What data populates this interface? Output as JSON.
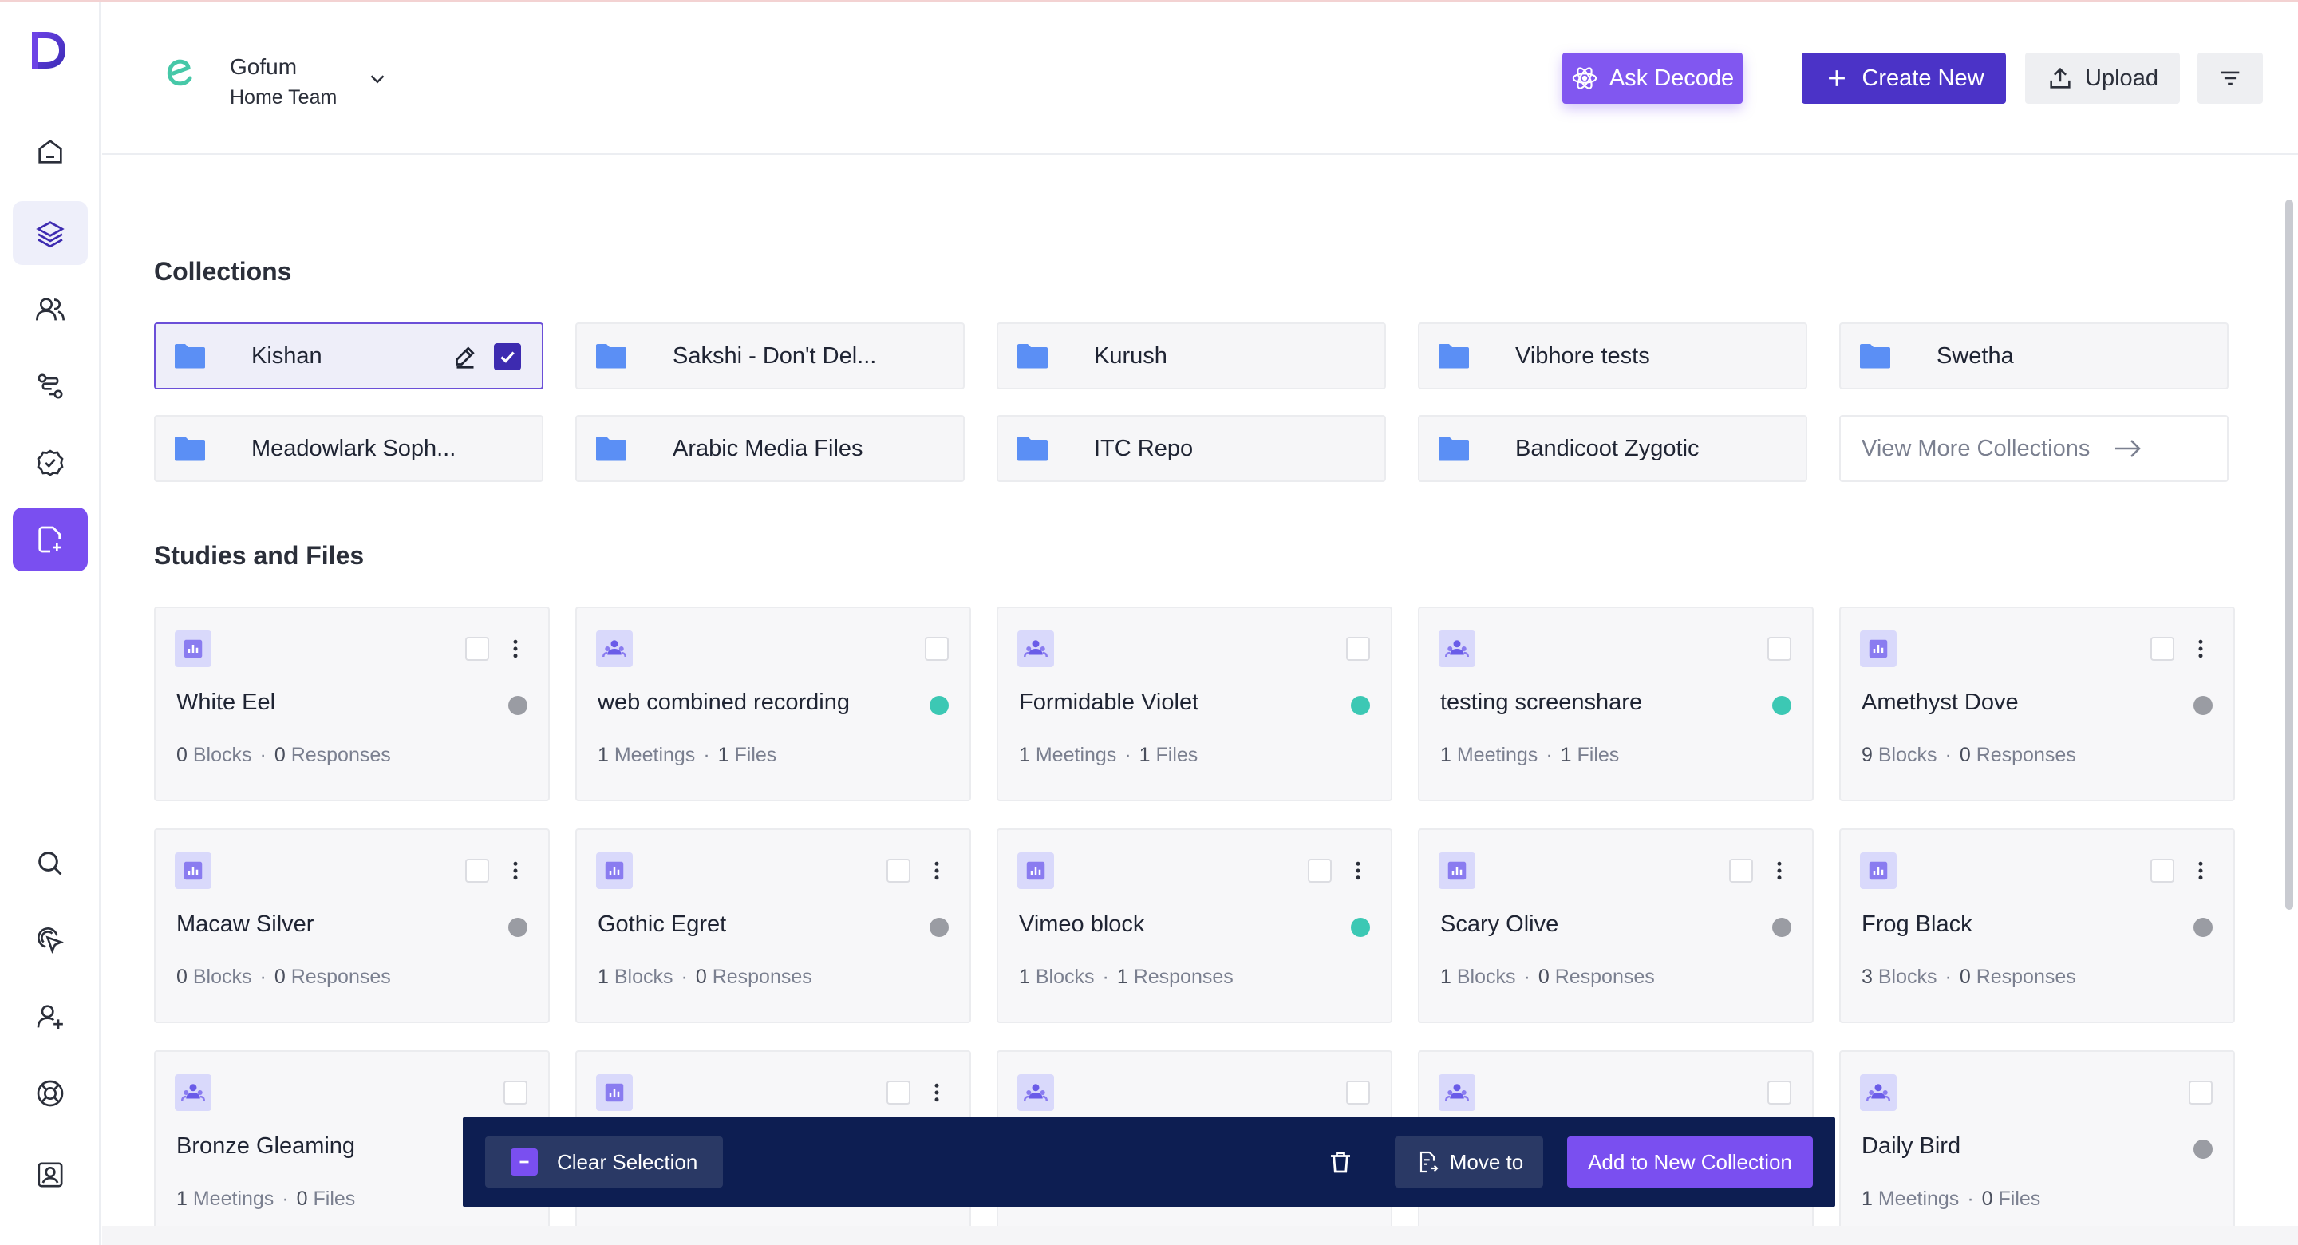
{
  "header": {
    "team_name": "Gofum",
    "team_sub": "Home Team",
    "ask_label": "Ask Decode",
    "create_label": "Create New",
    "upload_label": "Upload"
  },
  "sections": {
    "collections_title": "Collections",
    "studies_title": "Studies and Files"
  },
  "collections": [
    {
      "name": "Kishan",
      "selected": true
    },
    {
      "name": "Sakshi - Don't Del..."
    },
    {
      "name": "Kurush"
    },
    {
      "name": "Vibhore tests"
    },
    {
      "name": "Swetha"
    },
    {
      "name": "Meadowlark Soph..."
    },
    {
      "name": "Arabic Media Files"
    },
    {
      "name": "ITC Repo"
    },
    {
      "name": "Bandicoot Zygotic"
    }
  ],
  "view_more_label": "View More Collections",
  "cards": [
    {
      "title": "White Eel",
      "type": "block-icon",
      "status_color": "#9a9ca3",
      "a": "0",
      "a_label": "Blocks",
      "b": "0",
      "b_label": "Responses",
      "menu": true
    },
    {
      "title": "web combined recording",
      "type": "meeting-icon",
      "status_color": "#3cc8b4",
      "a": "1",
      "a_label": "Meetings",
      "b": "1",
      "b_label": "Files",
      "menu": false
    },
    {
      "title": "Formidable Violet",
      "type": "meeting-icon",
      "status_color": "#3cc8b4",
      "a": "1",
      "a_label": "Meetings",
      "b": "1",
      "b_label": "Files",
      "menu": false
    },
    {
      "title": "testing screenshare",
      "type": "meeting-icon",
      "status_color": "#3cc8b4",
      "a": "1",
      "a_label": "Meetings",
      "b": "1",
      "b_label": "Files",
      "menu": false
    },
    {
      "title": "Amethyst Dove",
      "type": "block-icon",
      "status_color": "#9a9ca3",
      "a": "9",
      "a_label": "Blocks",
      "b": "0",
      "b_label": "Responses",
      "menu": true
    },
    {
      "title": "Macaw Silver",
      "type": "block-icon",
      "status_color": "#9a9ca3",
      "a": "0",
      "a_label": "Blocks",
      "b": "0",
      "b_label": "Responses",
      "menu": true
    },
    {
      "title": "Gothic Egret",
      "type": "block-icon",
      "status_color": "#9a9ca3",
      "a": "1",
      "a_label": "Blocks",
      "b": "0",
      "b_label": "Responses",
      "menu": true
    },
    {
      "title": "Vimeo block",
      "type": "block-icon",
      "status_color": "#3cc8b4",
      "a": "1",
      "a_label": "Blocks",
      "b": "1",
      "b_label": "Responses",
      "menu": true
    },
    {
      "title": "Scary Olive",
      "type": "block-icon",
      "status_color": "#9a9ca3",
      "a": "1",
      "a_label": "Blocks",
      "b": "0",
      "b_label": "Responses",
      "menu": true
    },
    {
      "title": "Frog Black",
      "type": "block-icon",
      "status_color": "#9a9ca3",
      "a": "3",
      "a_label": "Blocks",
      "b": "0",
      "b_label": "Responses",
      "menu": true
    },
    {
      "title": "Bronze Gleaming",
      "type": "meeting-icon",
      "status_color": "",
      "a": "1",
      "a_label": "Meetings",
      "b": "0",
      "b_label": "Files",
      "menu": false
    },
    {
      "title": "",
      "type": "block-icon",
      "status_color": "",
      "a": "",
      "a_label": "",
      "b": "",
      "b_label": "",
      "menu": true
    },
    {
      "title": "",
      "type": "meeting-icon",
      "status_color": "",
      "a": "",
      "a_label": "",
      "b": "",
      "b_label": "",
      "menu": false
    },
    {
      "title": "",
      "type": "meeting-icon",
      "status_color": "",
      "a": "",
      "a_label": "",
      "b": "",
      "b_label": "",
      "menu": false
    },
    {
      "title": "Daily Bird",
      "type": "meeting-icon",
      "status_color": "#9a9ca3",
      "a": "1",
      "a_label": "Meetings",
      "b": "0",
      "b_label": "Files",
      "menu": false
    }
  ],
  "selection_bar": {
    "clear_label": "Clear Selection",
    "move_label": "Move to",
    "add_label": "Add to New Collection"
  },
  "colors": {
    "accent": "#7a4ff0",
    "primary": "#4b33c7",
    "folder": "#5b8ff5",
    "selection_bar": "#0d1e52"
  }
}
